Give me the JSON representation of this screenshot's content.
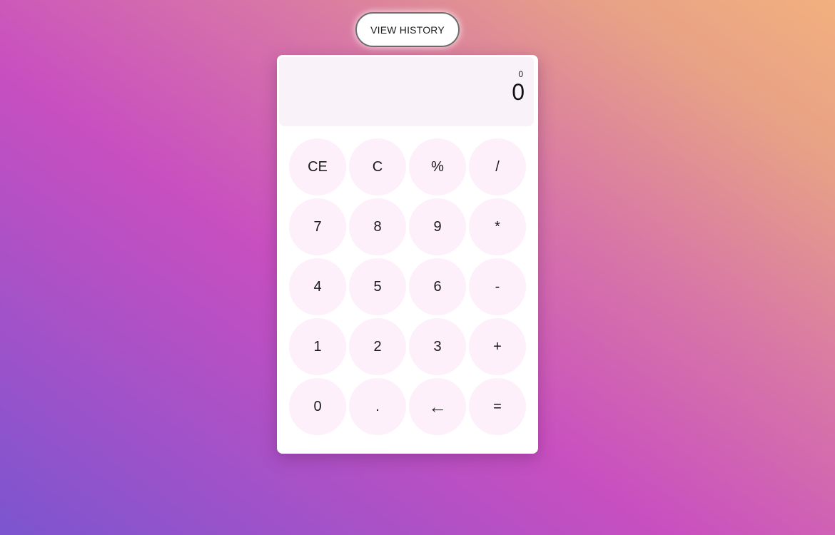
{
  "header": {
    "history_button_label": "VIEW HISTORY"
  },
  "display": {
    "previous": "0",
    "current": "0"
  },
  "keys": [
    {
      "label": "CE",
      "name": "clear-entry-button"
    },
    {
      "label": "C",
      "name": "clear-button"
    },
    {
      "label": "%",
      "name": "percent-button"
    },
    {
      "label": "/",
      "name": "divide-button"
    },
    {
      "label": "7",
      "name": "digit-7-button"
    },
    {
      "label": "8",
      "name": "digit-8-button"
    },
    {
      "label": "9",
      "name": "digit-9-button"
    },
    {
      "label": "*",
      "name": "multiply-button"
    },
    {
      "label": "4",
      "name": "digit-4-button"
    },
    {
      "label": "5",
      "name": "digit-5-button"
    },
    {
      "label": "6",
      "name": "digit-6-button"
    },
    {
      "label": "-",
      "name": "subtract-button"
    },
    {
      "label": "1",
      "name": "digit-1-button"
    },
    {
      "label": "2",
      "name": "digit-2-button"
    },
    {
      "label": "3",
      "name": "digit-3-button"
    },
    {
      "label": "+",
      "name": "add-button"
    },
    {
      "label": "0",
      "name": "digit-0-button"
    },
    {
      "label": ".",
      "name": "decimal-button"
    },
    {
      "label": "←",
      "name": "backspace-button"
    },
    {
      "label": "=",
      "name": "equals-button"
    }
  ],
  "colors": {
    "key_background": "#fdf0fb",
    "display_background": "#f9f2f9"
  }
}
